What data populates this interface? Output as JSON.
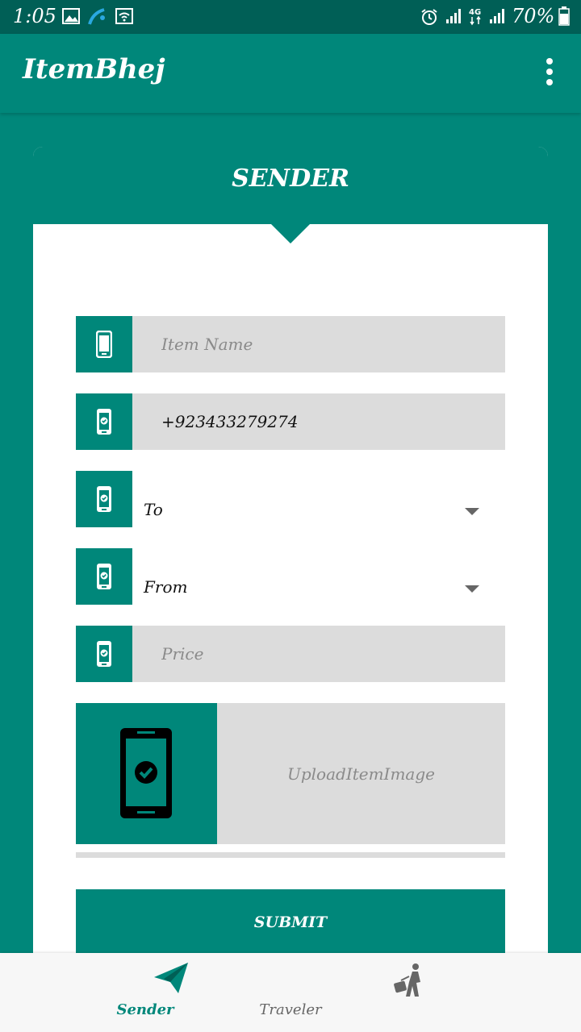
{
  "status_bar": {
    "time": "1:05",
    "battery": "70%",
    "icons": [
      "image-icon",
      "carrier-icon",
      "wifi-icon",
      "alarm-icon",
      "signal-icon",
      "4g-icon",
      "signal-icon",
      "battery-icon"
    ]
  },
  "app_bar": {
    "title": "ItemBhej",
    "menu_icon": "more-vert-icon"
  },
  "card": {
    "title": "SENDER"
  },
  "form": {
    "item_name": {
      "placeholder": "Item Name",
      "value": ""
    },
    "phone": {
      "value": "+923433279274"
    },
    "to": {
      "value": "To"
    },
    "from": {
      "value": "From"
    },
    "price": {
      "placeholder": "Price",
      "value": ""
    },
    "upload_label": "UploadItemImage",
    "submit_label": "SUBMIT"
  },
  "bottom_nav": {
    "items": [
      {
        "label": "Sender",
        "icon": "send-icon",
        "active": true
      },
      {
        "label": "Traveler",
        "icon": "traveler-icon",
        "active": false
      }
    ]
  },
  "colors": {
    "primary": "#00877a",
    "primary_dark": "#005f56",
    "input_bg": "#dcdcdc"
  }
}
